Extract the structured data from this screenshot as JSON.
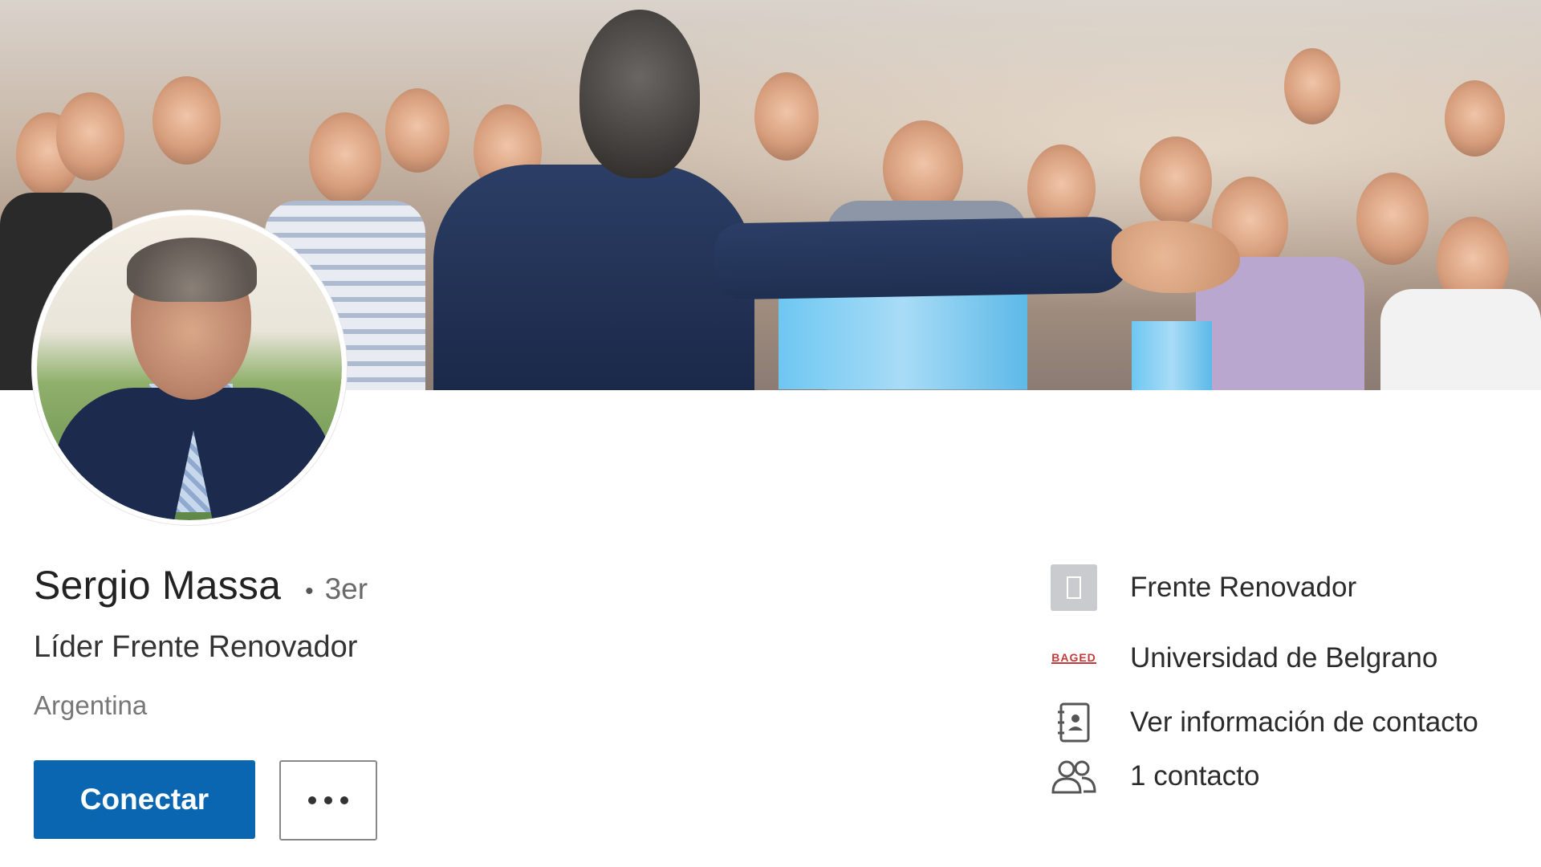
{
  "profile": {
    "name": "Sergio Massa",
    "degree": "3er",
    "headline": "Líder Frente Renovador",
    "location": "Argentina"
  },
  "actions": {
    "connect_label": "Conectar",
    "more_icon": "ellipsis-icon"
  },
  "sidebar": {
    "items": [
      {
        "label": "Frente Renovador",
        "icon": "company-building-icon"
      },
      {
        "label": "Universidad de Belgrano",
        "icon": "university-logo-icon",
        "logo_text": "BAGED"
      },
      {
        "label": "Ver información de contacto",
        "icon": "contact-book-icon"
      },
      {
        "label": "1 contacto",
        "icon": "people-icon"
      }
    ]
  },
  "colors": {
    "primary_button": "#0a66b1",
    "text": "#222222",
    "muted": "#777777"
  }
}
